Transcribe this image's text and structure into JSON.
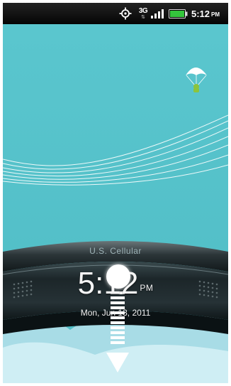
{
  "status_bar": {
    "network_type": "3G",
    "network_arrows": "⇅",
    "time": "5:12",
    "ampm": "PM",
    "icons": [
      "gps-icon",
      "3g-icon",
      "signal-icon",
      "battery-icon"
    ]
  },
  "lock_screen": {
    "carrier": "U.S. Cellular",
    "time": "5:12",
    "ampm": "PM",
    "date": "Mon, Jun 13, 2011",
    "unlock_hint": "drag-down-arrow-icon"
  },
  "colors": {
    "sky": "#56c3cb",
    "status_bar": "#0a0a0a",
    "battery": "#34c63c",
    "ring_dark": "#1e2a2d"
  }
}
